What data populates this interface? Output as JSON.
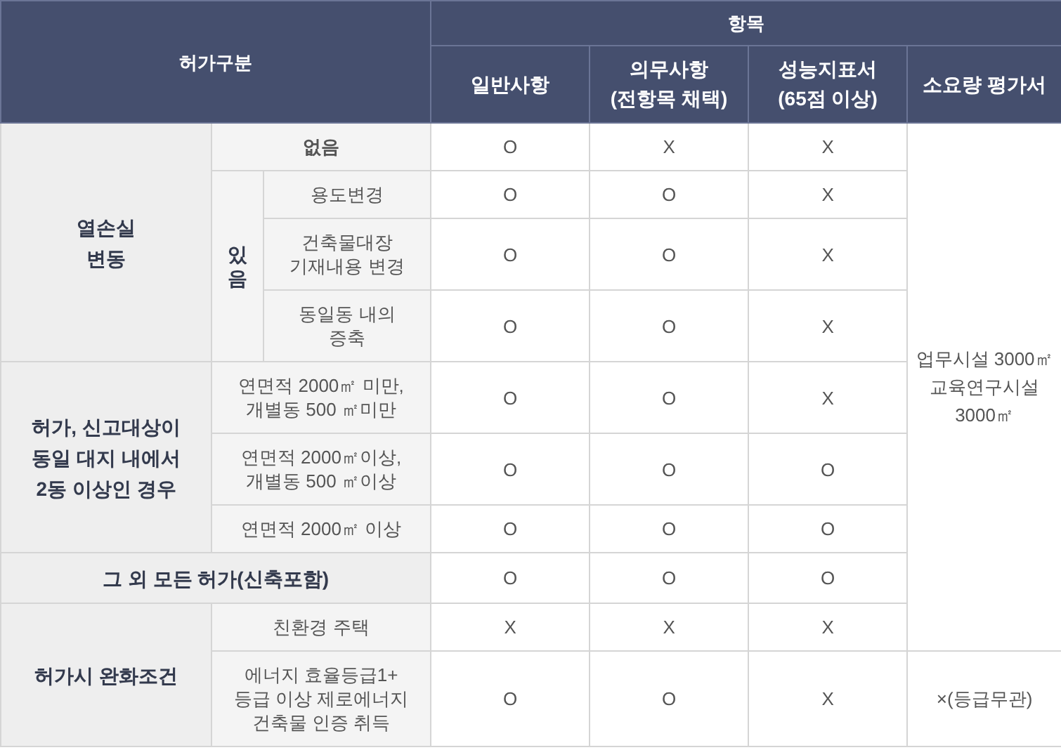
{
  "header": {
    "category": "허가구분",
    "items": "항목",
    "columns": [
      "일반사항",
      "의무사항\n(전항목 채택)",
      "성능지표서\n(65점 이상)",
      "소요량 평가서"
    ]
  },
  "sections": [
    {
      "label": "열손실\n변동",
      "items": [
        {
          "label": "없음",
          "values": [
            "O",
            "X",
            "X"
          ],
          "assessment": "업무시설 3000㎡\n교육연구시설\n3000㎡"
        },
        {
          "label": "있\n음",
          "children": [
            {
              "label": "용도변경",
              "values": [
                "O",
                "O",
                "X"
              ]
            },
            {
              "label": "건축물대장\n기재내용 변경",
              "values": [
                "O",
                "O",
                "X"
              ]
            },
            {
              "label": "동일동 내의\n증축",
              "values": [
                "O",
                "O",
                "X"
              ]
            }
          ]
        }
      ]
    },
    {
      "label": "허가, 신고대상이\n동일 대지 내에서\n2동 이상인 경우",
      "items": [
        {
          "label": "연면적 2000㎡ 미만,\n개별동 500 ㎡미만",
          "values": [
            "O",
            "O",
            "X"
          ]
        },
        {
          "label": "연면적 2000㎡이상,\n개별동 500 ㎡이상",
          "values": [
            "O",
            "O",
            "O"
          ]
        },
        {
          "label": "연면적 2000㎡ 이상",
          "values": [
            "O",
            "O",
            "O"
          ]
        }
      ]
    },
    {
      "label": "그 외 모든 허가(신축포함)",
      "values": [
        "O",
        "O",
        "O"
      ]
    },
    {
      "label": "허가시 완화조건",
      "items": [
        {
          "label": "친환경 주택",
          "values": [
            "X",
            "X",
            "X"
          ]
        },
        {
          "label": "에너지 효율등급1+\n등급 이상 제로에너지\n건축물 인증 취득",
          "values": [
            "O",
            "O",
            "X"
          ],
          "assessment": "×(등급무관)"
        }
      ]
    }
  ]
}
